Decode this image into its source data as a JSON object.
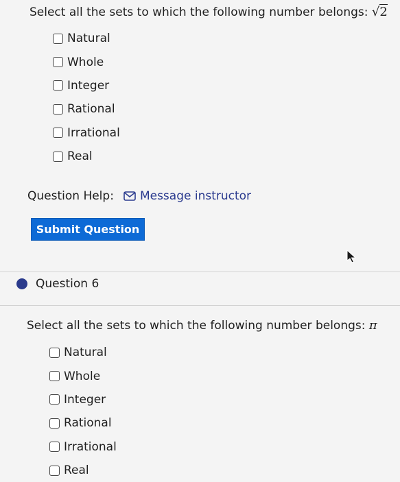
{
  "q5": {
    "prompt": "Select all the sets to which the following number belongs:",
    "math_radical": "√",
    "math_value": "2",
    "options": [
      "Natural",
      "Whole",
      "Integer",
      "Rational",
      "Irrational",
      "Real"
    ]
  },
  "help": {
    "label": "Question Help:",
    "link": "Message instructor",
    "icon": "envelope-icon"
  },
  "submit_label": "Submit Question",
  "q6": {
    "title": "Question 6",
    "prompt": "Select all the sets to which the following number belongs:",
    "math_value": "π",
    "options": [
      "Natural",
      "Whole",
      "Integer",
      "Rational",
      "Irrational",
      "Real"
    ]
  },
  "colors": {
    "background": "#f4f4f4",
    "submit_button": "#0d6ad6",
    "link": "#2b3b8f",
    "question_dot": "#2a3a8c"
  }
}
